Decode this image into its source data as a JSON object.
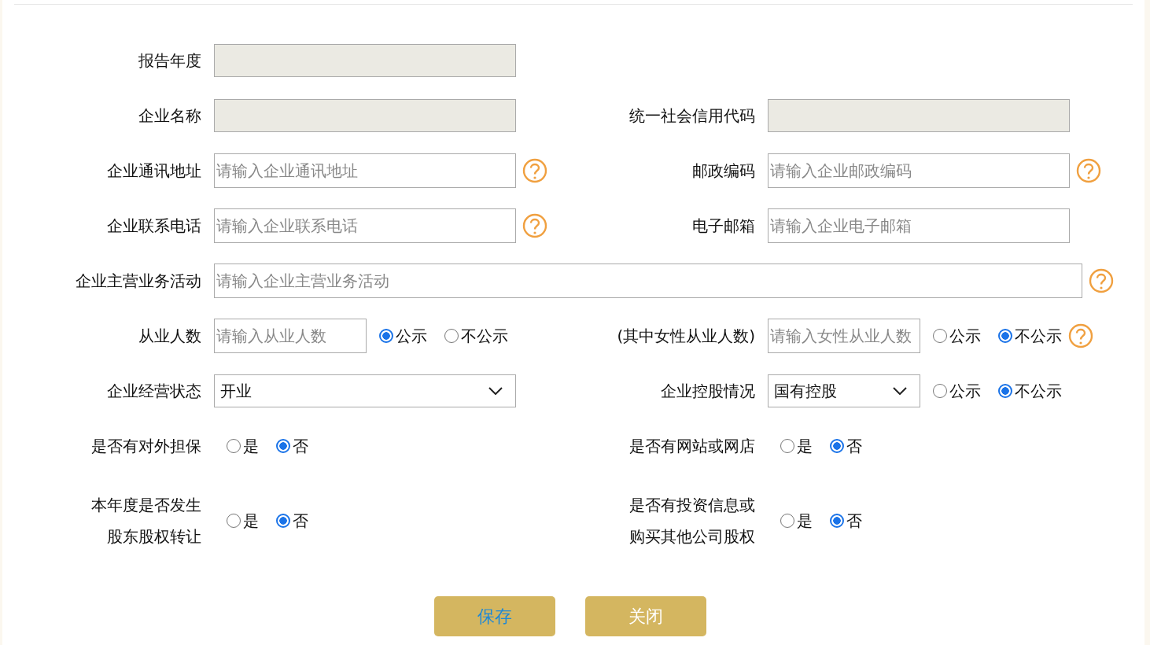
{
  "rows": [
    {
      "kind": "pair",
      "items": [
        {
          "label": "报告年度",
          "field": {
            "kind": "readonly"
          },
          "help": false
        }
      ]
    },
    {
      "kind": "pair",
      "items": [
        {
          "label": "企业名称",
          "field": {
            "kind": "readonly"
          },
          "help": false
        },
        {
          "label": "统一社会信用代码",
          "field": {
            "kind": "readonly"
          },
          "help": false
        }
      ]
    },
    {
      "kind": "pair",
      "items": [
        {
          "label": "企业通讯地址",
          "field": {
            "kind": "input",
            "placeholder": "请输入企业通讯地址"
          },
          "help": true
        },
        {
          "label": "邮政编码",
          "field": {
            "kind": "input",
            "placeholder": "请输入企业邮政编码"
          },
          "help": true
        }
      ]
    },
    {
      "kind": "pair",
      "items": [
        {
          "label": "企业联系电话",
          "field": {
            "kind": "input",
            "placeholder": "请输入企业联系电话"
          },
          "help": true
        },
        {
          "label": "电子邮箱",
          "field": {
            "kind": "input",
            "placeholder": "请输入企业电子邮箱"
          },
          "help": false
        }
      ]
    },
    {
      "kind": "full",
      "items": [
        {
          "label": "企业主营业务活动",
          "field": {
            "kind": "input",
            "placeholder": "请输入企业主营业务活动"
          },
          "help": true
        }
      ]
    },
    {
      "kind": "pair",
      "items": [
        {
          "label": "从业人数",
          "field": {
            "kind": "input",
            "placeholder": "请输入从业人数"
          },
          "options": [
            {
              "label": "公示",
              "selected": true
            },
            {
              "label": "不公示",
              "selected": false
            }
          ],
          "help": false
        },
        {
          "label": "(其中女性从业人数)",
          "field": {
            "kind": "input",
            "placeholder": "请输入女性从业人数"
          },
          "options": [
            {
              "label": "公示",
              "selected": false
            },
            {
              "label": "不公示",
              "selected": true
            }
          ],
          "help": true
        }
      ]
    },
    {
      "kind": "pair",
      "items": [
        {
          "label": "企业经营状态",
          "field": {
            "kind": "select",
            "value": "开业"
          },
          "help": false
        },
        {
          "label": "企业控股情况",
          "field": {
            "kind": "select",
            "value": "国有控股"
          },
          "options": [
            {
              "label": "公示",
              "selected": false
            },
            {
              "label": "不公示",
              "selected": true
            }
          ],
          "help": false
        }
      ]
    },
    {
      "kind": "pair",
      "items": [
        {
          "label": "是否有对外担保",
          "options": [
            {
              "label": "是",
              "selected": false
            },
            {
              "label": "否",
              "selected": true
            }
          ],
          "help": false
        },
        {
          "label": "是否有网站或网店",
          "options": [
            {
              "label": "是",
              "selected": false
            },
            {
              "label": "否",
              "selected": true
            }
          ],
          "help": false
        }
      ]
    },
    {
      "kind": "two-line",
      "items": [
        {
          "label": "本年度是否发生股东股权转让",
          "options": [
            {
              "label": "是",
              "selected": false
            },
            {
              "label": "否",
              "selected": true
            }
          ],
          "help": false
        },
        {
          "label": "是否有投资信息或购买其他公司股权",
          "options": [
            {
              "label": "是",
              "selected": false
            },
            {
              "label": "否",
              "selected": true
            }
          ],
          "help": false
        }
      ]
    }
  ],
  "buttons": [
    {
      "label": "保存",
      "kind": "accent"
    },
    {
      "label": "关闭",
      "kind": "plain"
    }
  ]
}
